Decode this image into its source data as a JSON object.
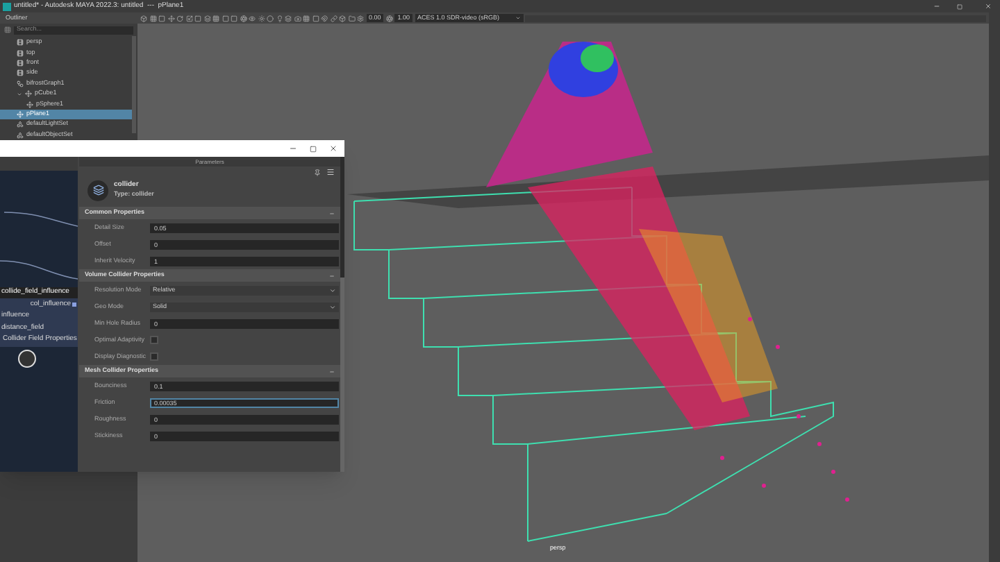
{
  "window": {
    "title": "untitled* - Autodesk MAYA 2022.3: untitled  ---  pPlane1"
  },
  "outliner": {
    "title": "Outliner",
    "search": {
      "placeholder": "Search..."
    },
    "items": [
      {
        "label": "persp",
        "kind": "camera",
        "selected": false
      },
      {
        "label": "top",
        "kind": "camera",
        "selected": false
      },
      {
        "label": "front",
        "kind": "camera",
        "selected": false
      },
      {
        "label": "side",
        "kind": "camera",
        "selected": false
      },
      {
        "label": "bifrostGraph1",
        "kind": "graph",
        "selected": false
      },
      {
        "label": "pCube1",
        "kind": "transform",
        "selected": false,
        "expanded": true,
        "children": [
          {
            "label": "pSphere1",
            "kind": "transform",
            "selected": false
          }
        ]
      },
      {
        "label": "pPlane1",
        "kind": "transform",
        "selected": true
      },
      {
        "label": "defaultLightSet",
        "kind": "set",
        "selected": false
      },
      {
        "label": "defaultObjectSet",
        "kind": "set",
        "selected": false
      }
    ]
  },
  "viewport": {
    "exposure": "0.00",
    "gamma": "1.00",
    "color_space": "ACES 1.0 SDR-video (sRGB)",
    "camera_label": "persp"
  },
  "graph": {
    "node_title": "collide_field_influence",
    "output_port": "col_influence",
    "inputs": [
      "influence",
      "distance_field"
    ],
    "group": "Collider Field Properties"
  },
  "parameters": {
    "title": "Parameters",
    "node_name": "collider",
    "node_type": "Type: collider",
    "sections": [
      {
        "title": "Common Properties",
        "expanded": true,
        "fields": [
          {
            "label": "Detail Size",
            "kind": "number",
            "value": "0.05",
            "focused": false
          },
          {
            "label": "Offset",
            "kind": "number",
            "value": "0",
            "focused": false
          },
          {
            "label": "Inherit Velocity",
            "kind": "number",
            "value": "1",
            "focused": false
          }
        ]
      },
      {
        "title": "Volume Collider Properties",
        "expanded": true,
        "fields": [
          {
            "label": "Resolution Mode",
            "kind": "dropdown",
            "value": "Relative"
          },
          {
            "label": "Geo Mode",
            "kind": "dropdown",
            "value": "Solid"
          },
          {
            "label": "Min Hole Radius",
            "kind": "number",
            "value": "0",
            "focused": false
          },
          {
            "label": "Optimal Adaptivity",
            "kind": "checkbox",
            "checked": false
          },
          {
            "label": "Display Diagnostic",
            "kind": "checkbox",
            "checked": false
          }
        ]
      },
      {
        "title": "Mesh Collider Properties",
        "expanded": true,
        "fields": [
          {
            "label": "Bounciness",
            "kind": "number",
            "value": "0.1",
            "focused": false
          },
          {
            "label": "Friction",
            "kind": "number",
            "value": "0.00035",
            "focused": true
          },
          {
            "label": "Roughness",
            "kind": "number",
            "value": "0",
            "focused": false
          },
          {
            "label": "Stickiness",
            "kind": "number",
            "value": "0",
            "focused": false
          }
        ]
      }
    ]
  }
}
